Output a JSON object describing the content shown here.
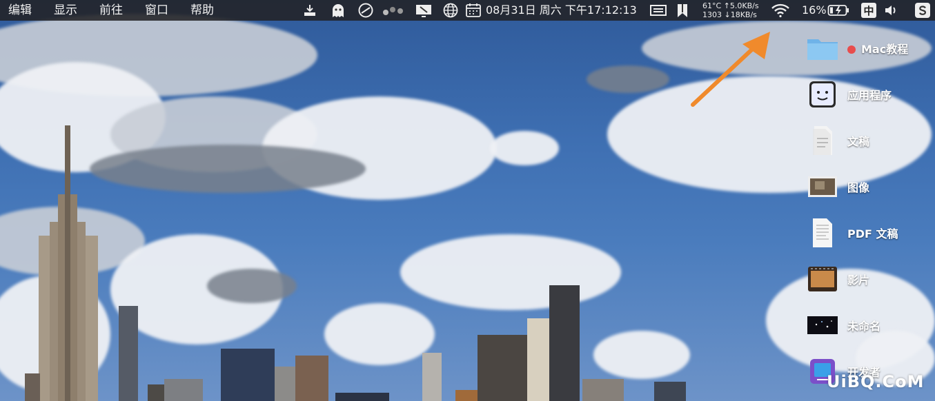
{
  "menubar": {
    "menus": [
      "编辑",
      "显示",
      "前往",
      "窗口",
      "帮助"
    ],
    "datetime": "08月31日 周六 下午17:12:13",
    "stats_line1": "61°C ↑5.0KB/s",
    "stats_line2": "1303 ↓18KB/s",
    "battery": "16%",
    "input_method": "中",
    "status_icons": [
      "download-icon",
      "ghost-icon",
      "compass-icon",
      "dots-icon",
      "screen-icon",
      "globe-icon",
      "calendar-icon",
      "display-icon",
      "bookmark-icon",
      "wifi-icon",
      "battery-charging-icon",
      "volume-icon",
      "app-s-icon"
    ]
  },
  "desktop": {
    "items": [
      {
        "label": "Mac教程",
        "icon": "folder-icon",
        "tag_color": "#e84d4d"
      },
      {
        "label": "应用程序",
        "icon": "finder-app-icon"
      },
      {
        "label": "文稿",
        "icon": "documents-icon"
      },
      {
        "label": "图像",
        "icon": "image-icon"
      },
      {
        "label": "PDF 文稿",
        "icon": "pdf-icon"
      },
      {
        "label": "影片",
        "icon": "movie-icon"
      },
      {
        "label": "未命名",
        "icon": "untitled-icon"
      },
      {
        "label": "开发者",
        "icon": "developer-icon"
      }
    ]
  },
  "annotation": {
    "arrow_color": "#f08a2c"
  },
  "watermark": "UiBQ.CoM"
}
